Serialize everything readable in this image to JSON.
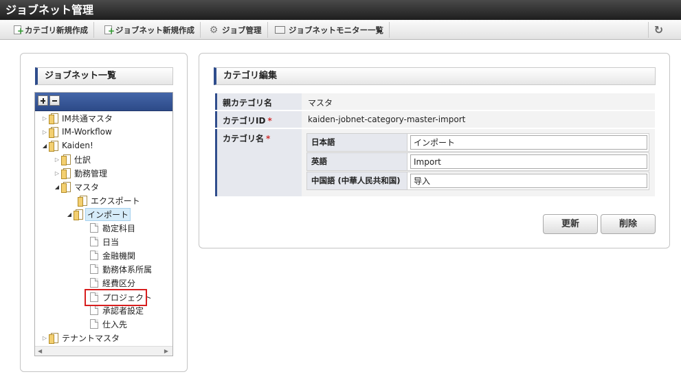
{
  "window": {
    "title": "ジョブネット管理"
  },
  "toolbar": {
    "items": [
      {
        "label": "カテゴリ新規作成",
        "icon": "new-document-icon"
      },
      {
        "label": "ジョブネット新規作成",
        "icon": "new-document-icon"
      },
      {
        "label": "ジョブ管理",
        "icon": "gear-icon"
      },
      {
        "label": "ジョブネットモニター一覧",
        "icon": "monitor-icon"
      }
    ],
    "refresh_icon": "refresh-icon"
  },
  "left_panel": {
    "title": "ジョブネット一覧",
    "tree": [
      {
        "label": "IM共通マスタ",
        "type": "folder",
        "expanded": false
      },
      {
        "label": "IM-Workflow",
        "type": "folder",
        "expanded": false
      },
      {
        "label": "Kaiden!",
        "type": "folder",
        "expanded": true
      },
      {
        "label": "仕訳",
        "type": "folder",
        "expanded": false
      },
      {
        "label": "勤務管理",
        "type": "folder",
        "expanded": false
      },
      {
        "label": "マスタ",
        "type": "folder",
        "expanded": true
      },
      {
        "label": "エクスポート",
        "type": "folder"
      },
      {
        "label": "インポート",
        "type": "folder",
        "expanded": true,
        "selected": true
      },
      {
        "label": "勘定科目",
        "type": "file"
      },
      {
        "label": "日当",
        "type": "file"
      },
      {
        "label": "金融機関",
        "type": "file"
      },
      {
        "label": "勤務体系所属",
        "type": "file"
      },
      {
        "label": "経費区分",
        "type": "file"
      },
      {
        "label": "プロジェクト",
        "type": "file",
        "highlighted": true
      },
      {
        "label": "承認者設定",
        "type": "file"
      },
      {
        "label": "仕入先",
        "type": "file"
      },
      {
        "label": "テナントマスタ",
        "type": "folder",
        "expanded": false
      }
    ]
  },
  "right_panel": {
    "title": "カテゴリ編集",
    "parent_category": {
      "label": "親カテゴリ名",
      "value": "マスタ"
    },
    "category_id": {
      "label": "カテゴリID",
      "required_mark": "*",
      "value": "kaiden-jobnet-category-master-import"
    },
    "category_name": {
      "label": "カテゴリ名",
      "required_mark": "*",
      "locales": [
        {
          "label": "日本語",
          "value": "インポート"
        },
        {
          "label": "英語",
          "value": "Import"
        },
        {
          "label": "中国語 (中華人民共和国)",
          "value": "导入"
        }
      ]
    },
    "buttons": {
      "update": "更新",
      "delete": "削除"
    }
  }
}
